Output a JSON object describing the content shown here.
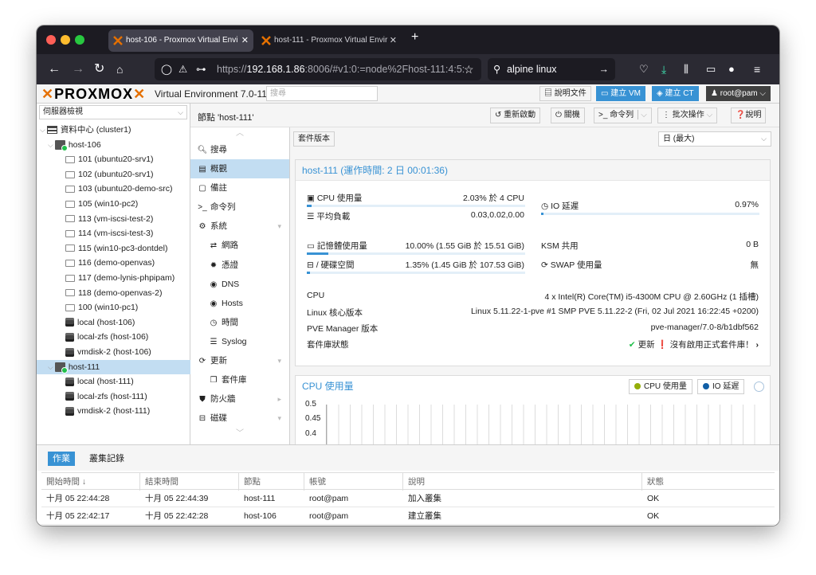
{
  "browser": {
    "tabs": [
      {
        "title": "host-106 - Proxmox Virtual Envi",
        "active": true
      },
      {
        "title": "host-111 - Proxmox Virtual Envir",
        "active": false
      }
    ],
    "url_prefix": "https://",
    "url_host": "192.168.1.86",
    "url_rest": ":8006/#v1:0:=node%2Fhost-111:4:5:",
    "search": "alpine linux"
  },
  "pve": {
    "logo": "PROXMOX",
    "version": "Virtual Environment 7.0-11",
    "search_placeholder": "搜尋",
    "buttons": {
      "docs": "說明文件",
      "create_vm": "建立 VM",
      "create_ct": "建立 CT",
      "user": "root@pam"
    }
  },
  "tree": {
    "view": "伺服器檢視",
    "items": [
      {
        "label": "資料中心 (cluster1)",
        "type": "datacenter",
        "indent": 0
      },
      {
        "label": "host-106",
        "type": "node",
        "indent": 1
      },
      {
        "label": "101 (ubuntu20-srv1)",
        "type": "vm",
        "indent": 2
      },
      {
        "label": "102 (ubuntu20-srv1)",
        "type": "vm",
        "indent": 2
      },
      {
        "label": "103 (ubuntu20-demo-src)",
        "type": "vm",
        "indent": 2
      },
      {
        "label": "105 (win10-pc2)",
        "type": "vm",
        "indent": 2
      },
      {
        "label": "113 (vm-iscsi-test-2)",
        "type": "vm",
        "indent": 2
      },
      {
        "label": "114 (vm-iscsi-test-3)",
        "type": "vm",
        "indent": 2
      },
      {
        "label": "115 (win10-pc3-dontdel)",
        "type": "vm",
        "indent": 2
      },
      {
        "label": "116 (demo-openvas)",
        "type": "vm",
        "indent": 2
      },
      {
        "label": "117 (demo-lynis-phpipam)",
        "type": "vm",
        "indent": 2
      },
      {
        "label": "118 (demo-openvas-2)",
        "type": "vm",
        "indent": 2
      },
      {
        "label": "100 (win10-pc1)",
        "type": "vm",
        "indent": 2
      },
      {
        "label": "local (host-106)",
        "type": "storage",
        "indent": 2
      },
      {
        "label": "local-zfs (host-106)",
        "type": "storage",
        "indent": 2
      },
      {
        "label": "vmdisk-2 (host-106)",
        "type": "storage",
        "indent": 2
      },
      {
        "label": "host-111",
        "type": "node",
        "indent": 1,
        "selected": true
      },
      {
        "label": "local (host-111)",
        "type": "storage",
        "indent": 2
      },
      {
        "label": "local-zfs (host-111)",
        "type": "storage",
        "indent": 2
      },
      {
        "label": "vmdisk-2 (host-111)",
        "type": "storage",
        "indent": 2
      }
    ]
  },
  "node": {
    "title": "節點 'host-111'",
    "actions": {
      "reboot": "重新啟動",
      "shutdown": "關機",
      "shell": "命令列",
      "bulk": "批次操作",
      "help": "說明"
    }
  },
  "menu": [
    {
      "label": "搜尋",
      "icon": "search-icon",
      "sub": false
    },
    {
      "label": "概觀",
      "icon": "book-icon",
      "sub": false,
      "selected": true
    },
    {
      "label": "備註",
      "icon": "note-icon",
      "sub": false
    },
    {
      "label": "命令列",
      "icon": "terminal-icon",
      "sub": false
    },
    {
      "label": "系統",
      "icon": "gears-icon",
      "sub": false,
      "expand": true
    },
    {
      "label": "網路",
      "icon": "exchange-icon",
      "sub": true
    },
    {
      "label": "憑證",
      "icon": "certificate-icon",
      "sub": true
    },
    {
      "label": "DNS",
      "icon": "globe-icon",
      "sub": true
    },
    {
      "label": "Hosts",
      "icon": "globe-icon",
      "sub": true
    },
    {
      "label": "時間",
      "icon": "clock-icon",
      "sub": true
    },
    {
      "label": "Syslog",
      "icon": "list-icon",
      "sub": true
    },
    {
      "label": "更新",
      "icon": "refresh-icon",
      "sub": false,
      "expand": true
    },
    {
      "label": "套件庫",
      "icon": "files-icon",
      "sub": true
    },
    {
      "label": "防火牆",
      "icon": "shield-icon",
      "sub": false,
      "collapsed": true
    },
    {
      "label": "磁碟",
      "icon": "hdd-icon",
      "sub": false,
      "expand": true
    }
  ],
  "overview": {
    "pkg_button": "套件版本",
    "timeframe": "日 (最大)",
    "status_title": "host-111 (運作時間: 2 日 00:01:36)",
    "cpu_label": "CPU 使用量",
    "cpu_value": "2.03% 於 4 CPU",
    "cpu_pct": 2.03,
    "io_label": "IO 延遲",
    "io_value": "0.97%",
    "load_label": "平均負載",
    "load_value": "0.03,0.02,0.00",
    "mem_label": "記憶體使用量",
    "mem_value": "10.00% (1.55 GiB 於 15.51 GiB)",
    "mem_pct": 10.0,
    "ksm_label": "KSM 共用",
    "ksm_value": "0 B",
    "disk_label": "/ 硬碟空間",
    "disk_value": "1.35% (1.45 GiB 於 107.53 GiB)",
    "disk_pct": 1.35,
    "swap_label": "SWAP 使用量",
    "swap_value": "無",
    "cpu_model_label": "CPU",
    "cpu_model_value": "4 x Intel(R) Core(TM) i5-4300M CPU @ 2.60GHz (1 插槽)",
    "kernel_label": "Linux 核心版本",
    "kernel_value": "Linux 5.11.22-1-pve #1 SMP PVE 5.11.22-2 (Fri, 02 Jul 2021 16:22:45 +0200)",
    "pve_label": "PVE Manager 版本",
    "pve_value": "pve-manager/7.0-8/b1dbf562",
    "repo_label": "套件庫狀態",
    "repo_ok": "更新",
    "repo_warn": "沒有啟用正式套件庫！"
  },
  "cpu_chart": {
    "title": "CPU 使用量",
    "legend": [
      "CPU 使用量",
      "IO 延遲"
    ],
    "yticks": [
      "0.5",
      "0.45",
      "0.4"
    ],
    "colors": {
      "cpu": "#94ae0a",
      "io": "#115fa6"
    }
  },
  "tasks": {
    "tabs": [
      "作業",
      "叢集記錄"
    ],
    "columns": [
      "開始時間 ↓",
      "結束時間",
      "節點",
      "帳號",
      "說明",
      "狀態"
    ],
    "rows": [
      [
        "十月 05 22:44:28",
        "十月 05 22:44:39",
        "host-111",
        "root@pam",
        "加入叢集",
        "OK"
      ],
      [
        "十月 05 22:42:17",
        "十月 05 22:42:28",
        "host-106",
        "root@pam",
        "建立叢集",
        "OK"
      ]
    ]
  },
  "colors": {
    "accent": "#3892d4",
    "selected": "#c2ddf2",
    "proxmox_orange": "#e57000"
  }
}
